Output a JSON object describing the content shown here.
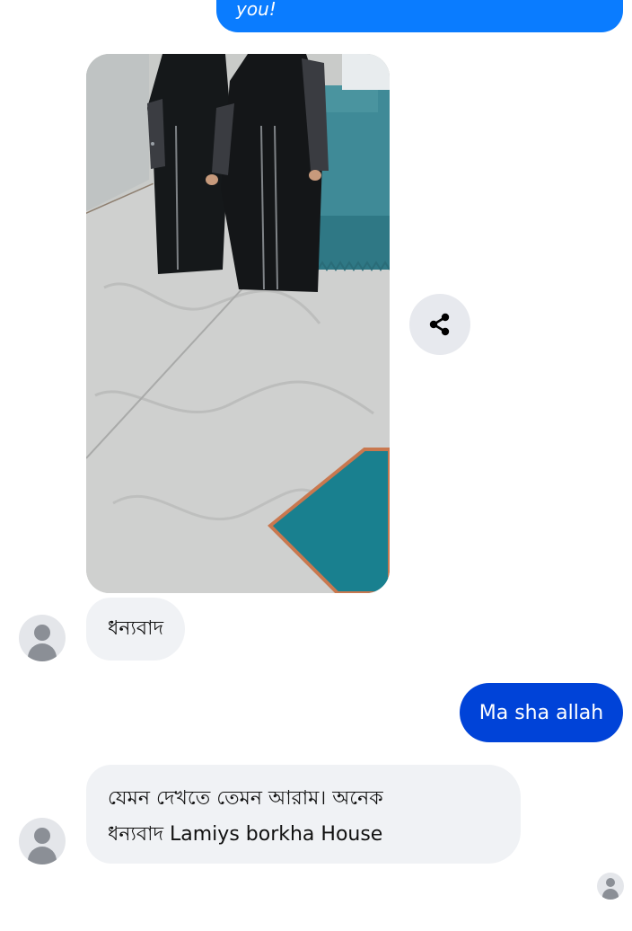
{
  "messages": {
    "top_outgoing_text": "you!",
    "received_thanks": "ধন্যবাদ",
    "sent_reply": "Ma sha allah",
    "received_long_line1": "যেমন দেখতে তেমন আরাম। অনেক",
    "received_long_line2": "ধন্যবাদ Lamiys borkha House"
  },
  "icons": {
    "share": "share-icon",
    "avatar": "person-icon"
  },
  "colors": {
    "outgoing_bubble_top": "#0a7cff",
    "outgoing_bubble": "#0043d8",
    "incoming_bubble": "#f0f2f5",
    "share_button_bg": "#e7e9ee"
  }
}
